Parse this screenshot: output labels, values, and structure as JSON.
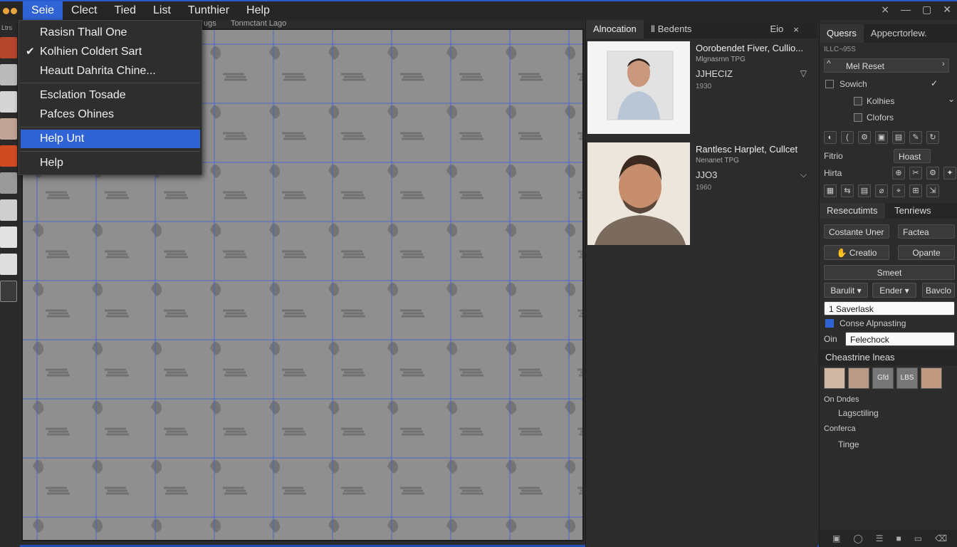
{
  "menubar": {
    "items": [
      "Seie",
      "Clect",
      "Tied",
      "List",
      "Tunthier",
      "Help"
    ],
    "active_index": 0
  },
  "dropdown": {
    "items": [
      {
        "label": "Rasisn Thall One",
        "checked": false,
        "selected": false
      },
      {
        "label": "Kolhien Coldert Sart",
        "checked": true,
        "selected": false
      },
      {
        "label": "Heautt Dahrita Chine...",
        "checked": false,
        "selected": false
      },
      {
        "label": "Esclation Tosade",
        "checked": false,
        "selected": false
      },
      {
        "label": "Pafces Ohines",
        "checked": false,
        "selected": false
      },
      {
        "label": "Help Unt",
        "checked": false,
        "selected": true
      },
      {
        "label": "Help",
        "checked": false,
        "selected": false
      }
    ]
  },
  "canvas": {
    "labels": [
      "ugs",
      "Tonmctant Lago"
    ]
  },
  "left_panel": {
    "label": "Ltrs"
  },
  "mid_panel": {
    "tabs": [
      "Alnocation",
      "Ⅱ Bedents",
      "Eio"
    ],
    "close": "×",
    "cards": [
      {
        "title": "Oorobendet Fiver, Cullio...",
        "sub": "Mlgnasrnn TPG",
        "code": "JJHECIZ",
        "meta": "1930",
        "arrow": "▽"
      },
      {
        "title": "Rantlesc Harplet, Cullcet",
        "sub": "Nenanet TPG",
        "code": "JJO3",
        "meta": "1960",
        "arrow": "⌵"
      }
    ]
  },
  "right_panel": {
    "tabs": [
      "Quesrs",
      "Appecrtorlew."
    ],
    "meta": "ILLC¬95S",
    "mel_field": "Mel Reset",
    "swich_label": "Sowich",
    "checkboxes": [
      "Kolhies",
      "Clofors"
    ],
    "rows": [
      {
        "label": "Fitrio"
      },
      {
        "label": "Hirta"
      }
    ],
    "rows_field": "Hoast",
    "section1_tabs": [
      "Resecutimts",
      "Tenriews"
    ],
    "cost_field": "Costante Uner",
    "fac_field": "Factea",
    "btn_creatio": "Creatio",
    "btn_opante": "Opante",
    "btn_smeet": "Smeet",
    "dd_buttons": [
      "Barulit",
      "Ender",
      "Bavclo"
    ],
    "saverlask": "Saverlask",
    "cone_label": "Conse Alpnasting",
    "oin_label": "Oin",
    "felechock": "Felechock",
    "section2": "Cheastrine lneas",
    "faces": [
      "",
      "",
      "Gfd",
      "LBS",
      "",
      ""
    ],
    "list": [
      "On Dndes",
      "Lagsctiling",
      "Conferca",
      "Tinge"
    ]
  }
}
